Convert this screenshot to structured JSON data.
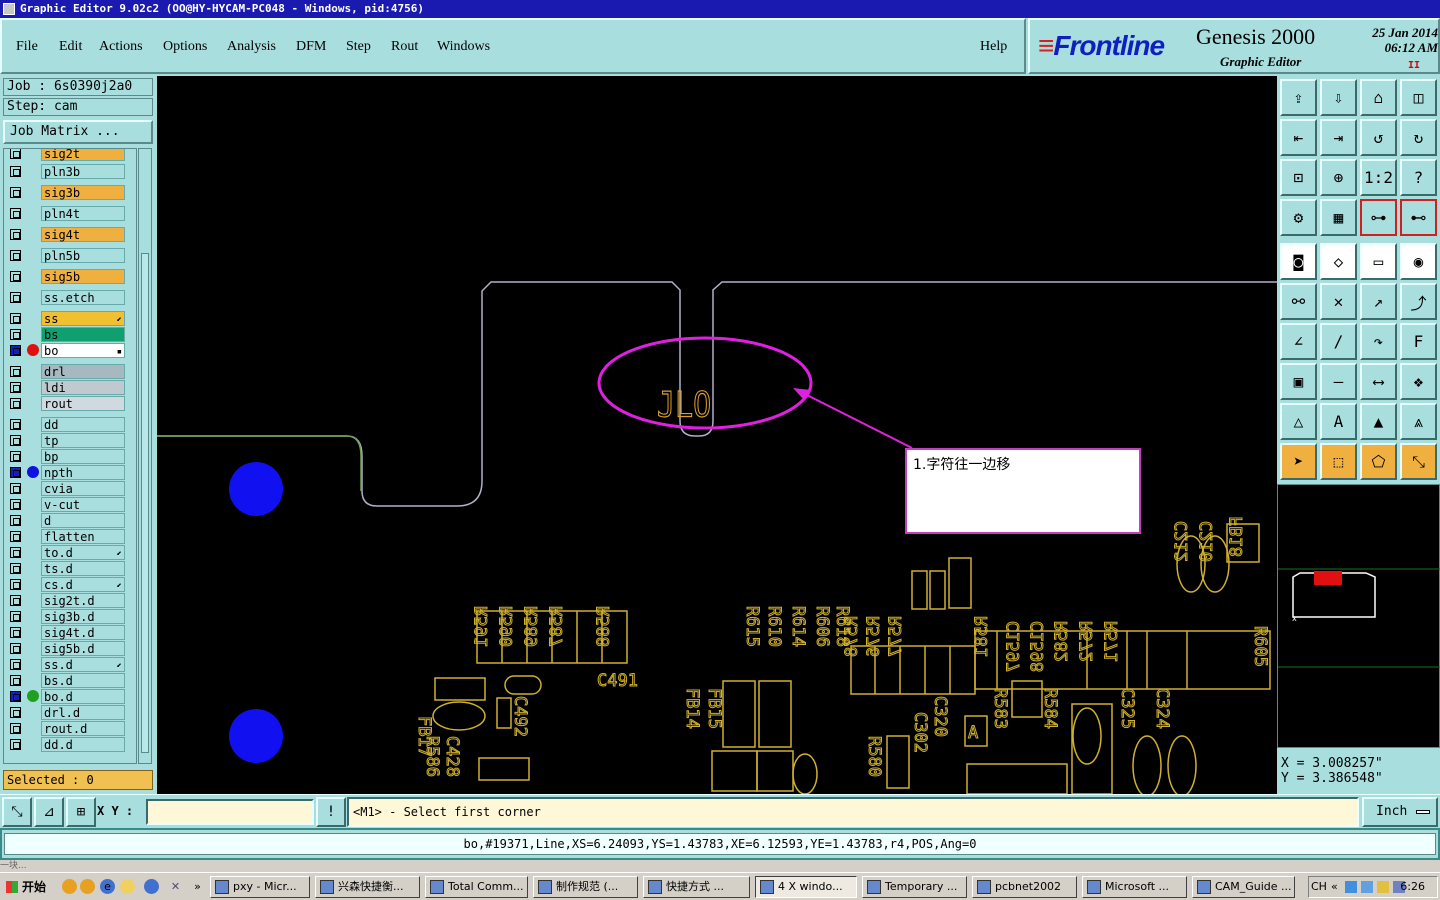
{
  "window": {
    "title": "Graphic Editor 9.02c2 (OO@HY-HYCAM-PC048 - Windows, pid:4756)"
  },
  "menu": {
    "items": [
      "File",
      "Edit",
      "Actions",
      "Options",
      "Analysis",
      "DFM",
      "Step",
      "Rout",
      "Windows"
    ],
    "help": "Help"
  },
  "brand": {
    "logo": "Frontline",
    "product": "Genesis 2000",
    "subtitle": "Graphic Editor",
    "date": "25 Jan 2014",
    "time": "06:12 AM",
    "rec_mark": "II"
  },
  "job": {
    "job_label": "Job : 6s0390j2a0",
    "step_label": "Step: cam",
    "matrix_button": "Job Matrix ..."
  },
  "layers": [
    {
      "name": "sig2t",
      "color": "#f0b040",
      "dot": "",
      "mark": ""
    },
    {
      "name": "pln3b",
      "color": "#a8dede",
      "dot": "",
      "mark": ""
    },
    {
      "name": "sig3b",
      "color": "#f0b040",
      "dot": "",
      "mark": ""
    },
    {
      "name": "pln4t",
      "color": "#a8dede",
      "dot": "",
      "mark": ""
    },
    {
      "name": "sig4t",
      "color": "#f0b040",
      "dot": "",
      "mark": ""
    },
    {
      "name": "pln5b",
      "color": "#a8dede",
      "dot": "",
      "mark": ""
    },
    {
      "name": "sig5b",
      "color": "#f0b040",
      "dot": "",
      "mark": ""
    },
    {
      "name": "ss.etch",
      "color": "#a8dede",
      "dot": "",
      "mark": ""
    },
    {
      "name": "ss",
      "color": "#f0c030",
      "dot": "",
      "mark": "⬋"
    },
    {
      "name": "bs",
      "color": "#10a070",
      "dot": "",
      "mark": ""
    },
    {
      "name": "bo",
      "color": "#ffffff",
      "dot": "#e01010",
      "mark": "▪"
    },
    {
      "name": "drl",
      "color": "#a8b8c0",
      "dot": "",
      "mark": ""
    },
    {
      "name": "ldi",
      "color": "#c0c8d0",
      "dot": "",
      "mark": ""
    },
    {
      "name": "rout",
      "color": "#d0d8e0",
      "dot": "",
      "mark": ""
    },
    {
      "name": "dd",
      "color": "#a8dede",
      "dot": "",
      "mark": ""
    },
    {
      "name": "tp",
      "color": "#a8dede",
      "dot": "",
      "mark": ""
    },
    {
      "name": "bp",
      "color": "#a8dede",
      "dot": "",
      "mark": ""
    },
    {
      "name": "npth",
      "color": "#a8dede",
      "dot": "#1010e0",
      "mark": ""
    },
    {
      "name": "cvia",
      "color": "#a8dede",
      "dot": "",
      "mark": ""
    },
    {
      "name": "v-cut",
      "color": "#a8dede",
      "dot": "",
      "mark": ""
    },
    {
      "name": "d",
      "color": "#a8dede",
      "dot": "",
      "mark": ""
    },
    {
      "name": "flatten",
      "color": "#a8dede",
      "dot": "",
      "mark": ""
    },
    {
      "name": "to.d",
      "color": "#a8dede",
      "dot": "",
      "mark": "⬋"
    },
    {
      "name": "ts.d",
      "color": "#a8dede",
      "dot": "",
      "mark": ""
    },
    {
      "name": "cs.d",
      "color": "#a8dede",
      "dot": "",
      "mark": "⬋"
    },
    {
      "name": "sig2t.d",
      "color": "#a8dede",
      "dot": "",
      "mark": ""
    },
    {
      "name": "sig3b.d",
      "color": "#a8dede",
      "dot": "",
      "mark": ""
    },
    {
      "name": "sig4t.d",
      "color": "#a8dede",
      "dot": "",
      "mark": ""
    },
    {
      "name": "sig5b.d",
      "color": "#a8dede",
      "dot": "",
      "mark": ""
    },
    {
      "name": "ss.d",
      "color": "#a8dede",
      "dot": "",
      "mark": "⬋"
    },
    {
      "name": "bs.d",
      "color": "#a8dede",
      "dot": "",
      "mark": ""
    },
    {
      "name": "bo.d",
      "color": "#a8dede",
      "dot": "#20a020",
      "mark": ""
    },
    {
      "name": "drl.d",
      "color": "#a8dede",
      "dot": "",
      "mark": ""
    },
    {
      "name": "rout.d",
      "color": "#a8dede",
      "dot": "",
      "mark": ""
    },
    {
      "name": "dd.d",
      "color": "#a8dede",
      "dot": "",
      "mark": ""
    }
  ],
  "selected": "Selected : 0",
  "annotation": "1.字符往一边移",
  "canvas_text": {
    "ref_top": [
      "R591",
      "R590",
      "R589",
      "R587",
      "R588"
    ],
    "ref_mid": [
      "R615",
      "R610",
      "R614",
      "R606",
      "R618"
    ],
    "ref_right": [
      "R578",
      "R576",
      "R577",
      "R581",
      "C1597",
      "C1598",
      "R582",
      "R572",
      "R571"
    ],
    "cap_right": [
      "C212",
      "C210",
      "FB18"
    ],
    "low_left": [
      "C491",
      "FB17",
      "C492",
      "R586",
      "C428"
    ],
    "low_mid": [
      "FB14",
      "FB15",
      "R580",
      "C302",
      "C320",
      "A",
      "R583",
      "R584",
      "C325",
      "C324",
      "R605"
    ],
    "partial": [
      "JLO"
    ]
  },
  "coords": {
    "x": "X = 3.008257\"",
    "y": "Y = 3.386548\""
  },
  "status": {
    "xy_label": "X Y :",
    "xy_value": "",
    "prompt": "<M1> - Select first corner",
    "unit": "Inch"
  },
  "info": "bo,#19371,Line,XS=6.24093,YS=1.43783,XE=6.12593,YE=1.43783,r4,POS,Ang=0",
  "behind_text": "一块...",
  "taskbar": {
    "start": "开始",
    "tasks": [
      "pxy - Micr...",
      "兴森快捷衡...",
      "Total Comm...",
      "制作规范 (...",
      "快捷方式 ...",
      "4 X windo...",
      "Temporary ...",
      "pcbnet2002",
      "Microsoft ...",
      "CAM_Guide ..."
    ],
    "active_index": 5,
    "clock": "6:26"
  }
}
